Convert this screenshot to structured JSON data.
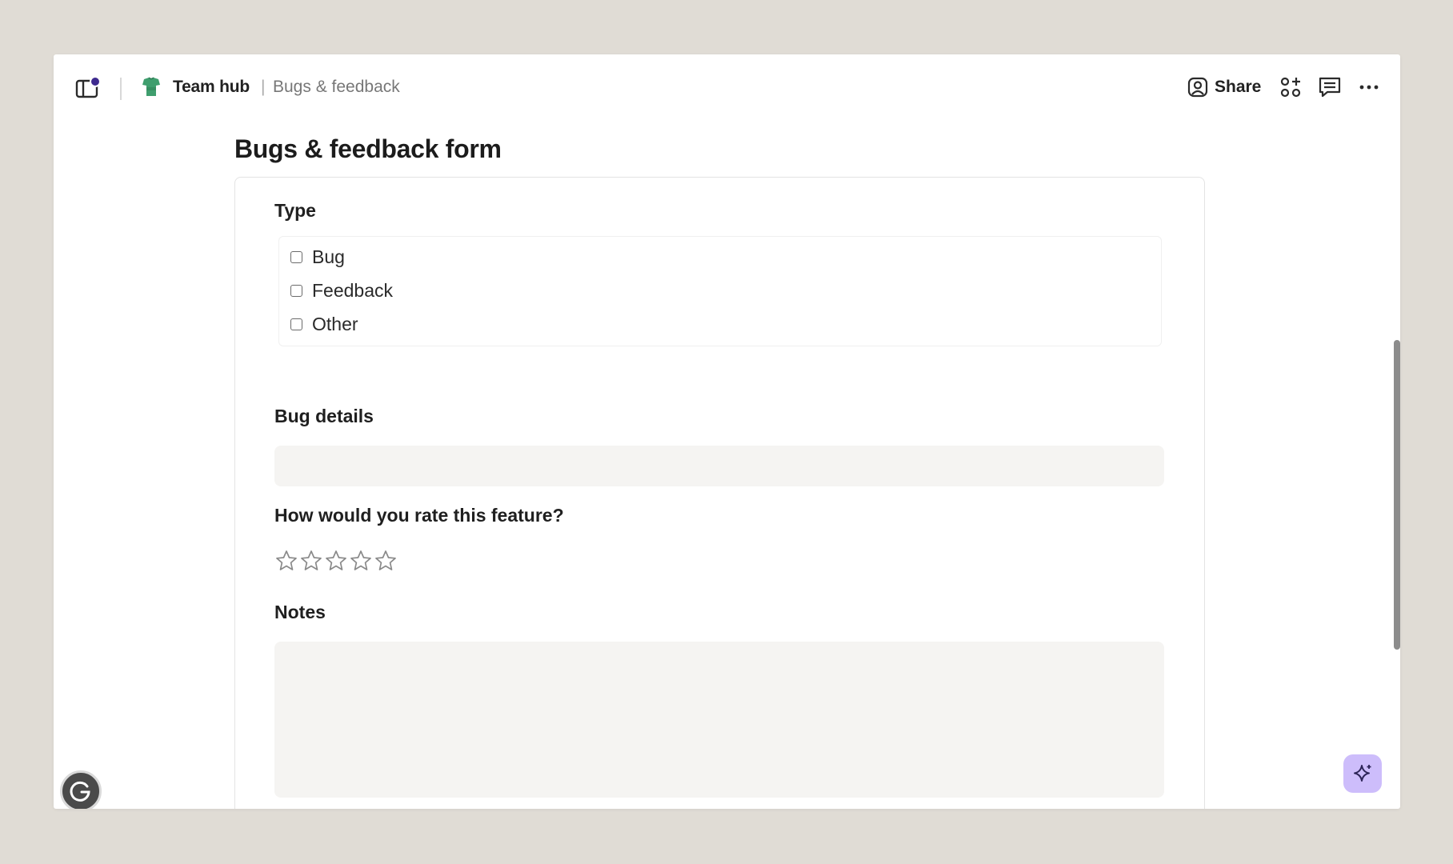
{
  "breadcrumb": {
    "hub": "Team hub",
    "separator": "|",
    "page": "Bugs & feedback"
  },
  "toolbar": {
    "share_label": "Share",
    "icons": [
      "user-circle-icon",
      "apps-add-icon",
      "comment-icon",
      "more-icon"
    ]
  },
  "form": {
    "title": "Bugs & feedback form",
    "type": {
      "label": "Type",
      "options": [
        {
          "label": "Bug",
          "checked": false
        },
        {
          "label": "Feedback",
          "checked": false
        },
        {
          "label": "Other",
          "checked": false
        }
      ]
    },
    "bug_details": {
      "label": "Bug details",
      "value": ""
    },
    "rating": {
      "label": "How would you rate this feature?",
      "max_stars": 5,
      "value": 0
    },
    "notes": {
      "label": "Notes",
      "value": ""
    }
  },
  "colors": {
    "background": "#e0dcd5",
    "notification_dot": "#3e2a8f",
    "ai_button": "#cdbdfb",
    "input_fill": "#f5f4f2"
  }
}
